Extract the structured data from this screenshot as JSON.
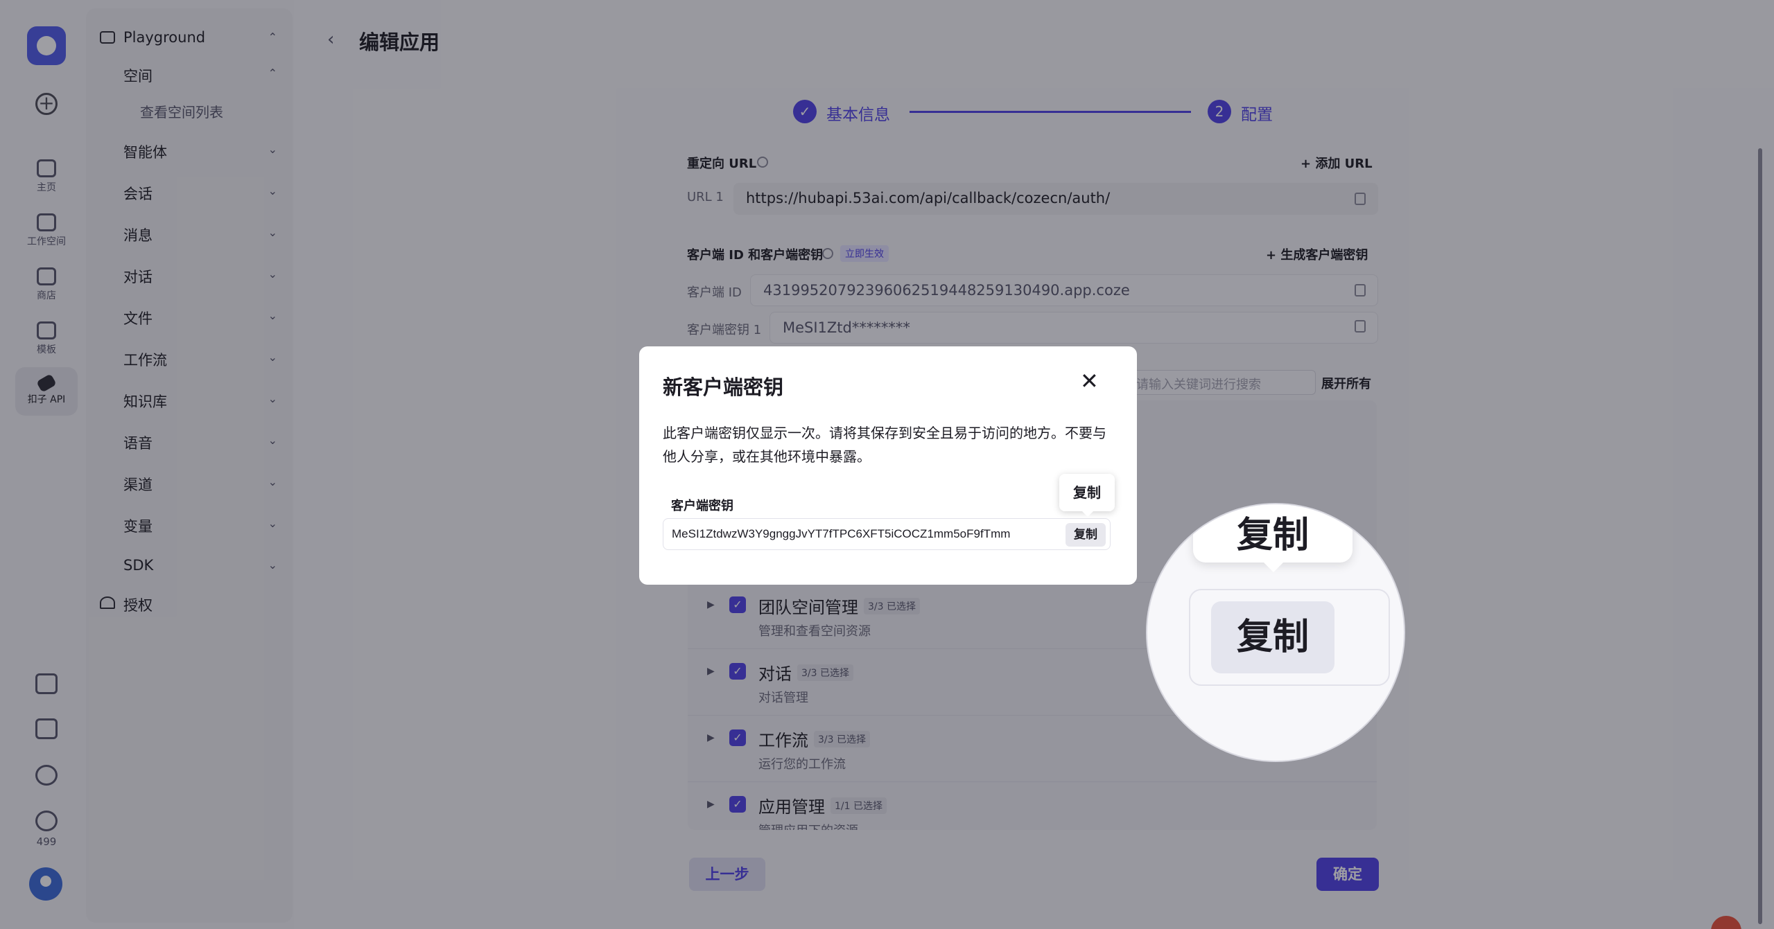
{
  "rail": {
    "items": [
      {
        "label": "主页",
        "icon": "home-icon"
      },
      {
        "label": "工作空间",
        "icon": "workspace-icon"
      },
      {
        "label": "商店",
        "icon": "store-icon"
      },
      {
        "label": "模板",
        "icon": "template-icon"
      },
      {
        "label": "扣子 API",
        "icon": "api-plug-icon",
        "active": true
      }
    ],
    "count": "499"
  },
  "sidebar": {
    "group_title": "Playground",
    "space": "空间",
    "space_sub": "查看空间列表",
    "items": [
      "智能体",
      "会话",
      "消息",
      "对话",
      "文件",
      "工作流",
      "知识库",
      "语音",
      "渠道",
      "变量",
      "SDK"
    ],
    "auth": "授权"
  },
  "header": {
    "title": "编辑应用"
  },
  "stepper": {
    "step1_label": "基本信息",
    "step2_num": "2",
    "step2_label": "配置"
  },
  "redirect": {
    "label": "重定向 URL",
    "add": "+ 添加 URL",
    "url_label": "URL 1",
    "url_value": "https://hubapi.53ai.com/api/callback/cozecn/auth/"
  },
  "client": {
    "label": "客户端 ID 和客户端密钥",
    "badge": "立即生效",
    "generate": "+ 生成客户端密钥",
    "id_label": "客户端 ID",
    "id_value": "43199520792396062519448259130490.app.coze",
    "secret_label": "客户端密钥 1",
    "secret_value": "MeSI1Ztd********"
  },
  "perms": {
    "search_placeholder": "请输入关键词进行搜索",
    "expand_all": "展开所有",
    "items": [
      {
        "name": "团队空间管理",
        "count": "3/3 已选择",
        "desc": "管理和查看空间资源"
      },
      {
        "name": "对话",
        "count": "3/3 已选择",
        "desc": "对话管理"
      },
      {
        "name": "工作流",
        "count": "3/3 已选择",
        "desc": "运行您的工作流"
      },
      {
        "name": "应用管理",
        "count": "1/1 已选择",
        "desc": "管理应用下的资源"
      }
    ]
  },
  "footer": {
    "prev": "上一步",
    "ok": "确定"
  },
  "modal": {
    "title": "新客户端密钥",
    "desc": "此客户端密钥仅显示一次。请将其保存到安全且易于访问的地方。不要与他人分享，或在其他环境中暴露。",
    "field_label": "客户端密钥",
    "secret": "MeSI1ZtdwzW3Y9gnggJvYT7fTPC6XFT5iCOCZ1mm5oF9fTmm",
    "copy": "复制",
    "tooltip": "复制"
  },
  "magnifier": {
    "tooltip": "复制",
    "button": "复制"
  },
  "colors": {
    "accent": "#4e40e5",
    "overlay": "rgba(25,25,35,0.42)"
  }
}
